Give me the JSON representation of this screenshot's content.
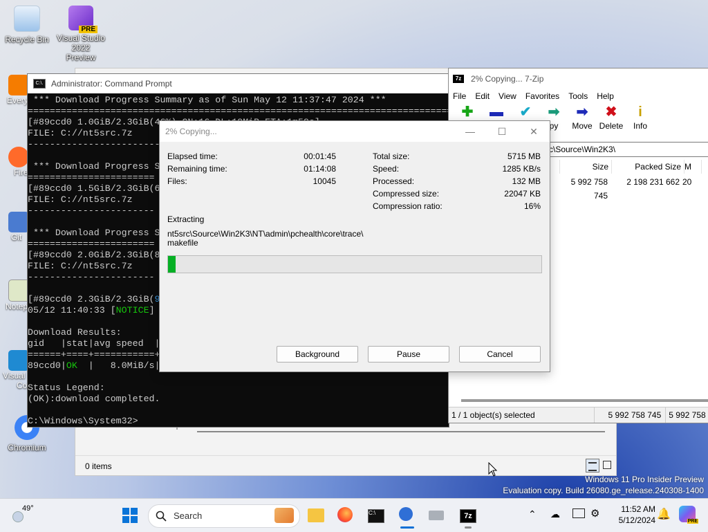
{
  "desktop": {
    "recycle_bin": "Recycle Bin",
    "vs_line1": "Visual Studio",
    "vs_line2": "2022 Preview",
    "vs_badge": "PRE",
    "partial_every": "Every",
    "partial_fire": "Fire",
    "partial_git": "Git",
    "partial_notep": "Notep",
    "partial_visual": "Visual",
    "partial_co": "Co",
    "chromium": "Chromium"
  },
  "cmd": {
    "title": "Administrator: Command Prompt",
    "icon_text": "C:\\.",
    "lines": [
      " *** Download Progress Summary as of Sun May 12 11:37:47 2024 ***",
      "===============================================================================",
      "[#89ccd0 1.0GiB/2.3GiB(46%) CN:16 DL:19MiB ETA:1m59s]",
      "FILE: C://nt5src.7z",
      "-------------------------------------------------------------------------------",
      "",
      " *** Download Progress S",
      "=======================",
      "[#89ccd0 1.5GiB/2.3GiB(6",
      "FILE: C://nt5src.7z",
      "-----------------------",
      "",
      " *** Download Progress S",
      "=======================",
      "[#89ccd0 2.0GiB/2.3GiB(8",
      "FILE: C://nt5src.7z",
      "-----------------------",
      "",
      "[#89ccd0 2.3GiB/2.3GiB(",
      "05/12 11:40:33 [",
      "",
      "Download Results:",
      "gid   |stat|avg speed  |",
      "======+====+===========+",
      "89ccd0|",
      "",
      "Status Legend:",
      "(OK):download completed.",
      "",
      "C:\\Windows\\System32>"
    ],
    "notice": "NOTICE",
    "notice_close": "]",
    "ok": "OK",
    "speed_rest": "  |   8.0MiB/s|",
    "pct_cont": "9"
  },
  "sevenzip": {
    "title": "2% Copying... 7-Zip",
    "icon_text": "7z",
    "menu": [
      "File",
      "Edit",
      "View",
      "Favorites",
      "Tools",
      "Help"
    ],
    "toolbar": {
      "copy": "py",
      "move": "Move",
      "delete": "Delete",
      "info": "Info"
    },
    "address": "c\\Source\\Win2K3\\",
    "columns": {
      "size": "Size",
      "packed": "Packed Size",
      "m": "M"
    },
    "row": {
      "size": "5 992 758 745",
      "packed": "2 198 231 662",
      "m": "20"
    },
    "status": {
      "selected": "1 / 1 object(s) selected",
      "size1": "5 992 758 745",
      "size2": "5 992 758"
    }
  },
  "dialog": {
    "title": "2% Copying...",
    "elapsed_label": "Elapsed time:",
    "elapsed": "00:01:45",
    "remaining_label": "Remaining time:",
    "remaining": "01:14:08",
    "files_label": "Files:",
    "files": "10045",
    "total_label": "Total size:",
    "total": "5715 MB",
    "speed_label": "Speed:",
    "speed": "1285 KB/s",
    "processed_label": "Processed:",
    "processed": "132 MB",
    "compressed_label": "Compressed size:",
    "compressed": "22047 KB",
    "ratio_label": "Compression ratio:",
    "ratio": "16%",
    "action": "Extracting",
    "path_line1": "nt5src\\Source\\Win2K3\\NT\\admin\\pchealth\\core\\trace\\",
    "path_line2": "makefile",
    "progress_fraction": 0.02,
    "buttons": {
      "background": "Background",
      "pause": "Pause",
      "cancel": "Cancel"
    }
  },
  "explorer": {
    "items": "0 items"
  },
  "watermark": {
    "line1": "Windows 11 Pro Insider Preview",
    "line2": "Evaluation copy. Build 26080.ge_release.240308-1400"
  },
  "taskbar": {
    "weather": "49°",
    "search_placeholder": "Search",
    "time": "11:52 AM",
    "date": "5/12/2024",
    "copilot_badge": "PRE"
  },
  "colors": {
    "progress_green": "#06b025",
    "console_green": "#16c60c",
    "console_cyan": "#3a96dd"
  }
}
